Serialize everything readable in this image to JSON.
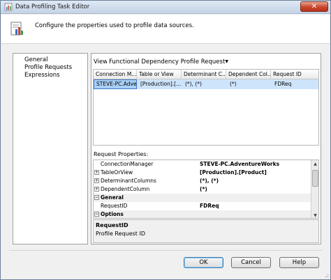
{
  "window": {
    "title": "Data Profiling Task Editor",
    "close_label": "✕"
  },
  "header": {
    "text": "Configure the properties used to profile data sources."
  },
  "nav": {
    "items": [
      {
        "label": "General"
      },
      {
        "label": "Profile Requests"
      },
      {
        "label": "Expressions"
      }
    ]
  },
  "view": {
    "label": "View",
    "selected": "Functional Dependency Profile Request"
  },
  "grid": {
    "columns": [
      "Connection M...",
      "Table or View",
      "Determinant C...",
      "Dependent Col...",
      "Request ID"
    ],
    "rows": [
      [
        "STEVE-PC.Adve...",
        "[Production].[...",
        "(*), (*)",
        "(*)",
        "FDReq"
      ]
    ]
  },
  "request_properties": {
    "label": "Request Properties:",
    "rows": [
      {
        "name": "ConnectionManager",
        "value": "STEVE-PC.AdventureWorks",
        "expander": ""
      },
      {
        "name": "TableOrView",
        "value": "[Production].[Product]",
        "expander": "+"
      },
      {
        "name": "DeterminantColumns",
        "value": "(*), (*)",
        "expander": "+"
      },
      {
        "name": "DependentColumn",
        "value": "(*)",
        "expander": "+"
      },
      {
        "name": "General",
        "value": "",
        "expander": "−"
      },
      {
        "name": "RequestID",
        "value": "FDReq",
        "expander": ""
      },
      {
        "name": "Options",
        "value": "",
        "expander": "−"
      }
    ]
  },
  "description": {
    "title": "RequestID",
    "text": "Profile Request ID"
  },
  "buttons": {
    "ok": "OK",
    "cancel": "Cancel",
    "help": "Help"
  }
}
